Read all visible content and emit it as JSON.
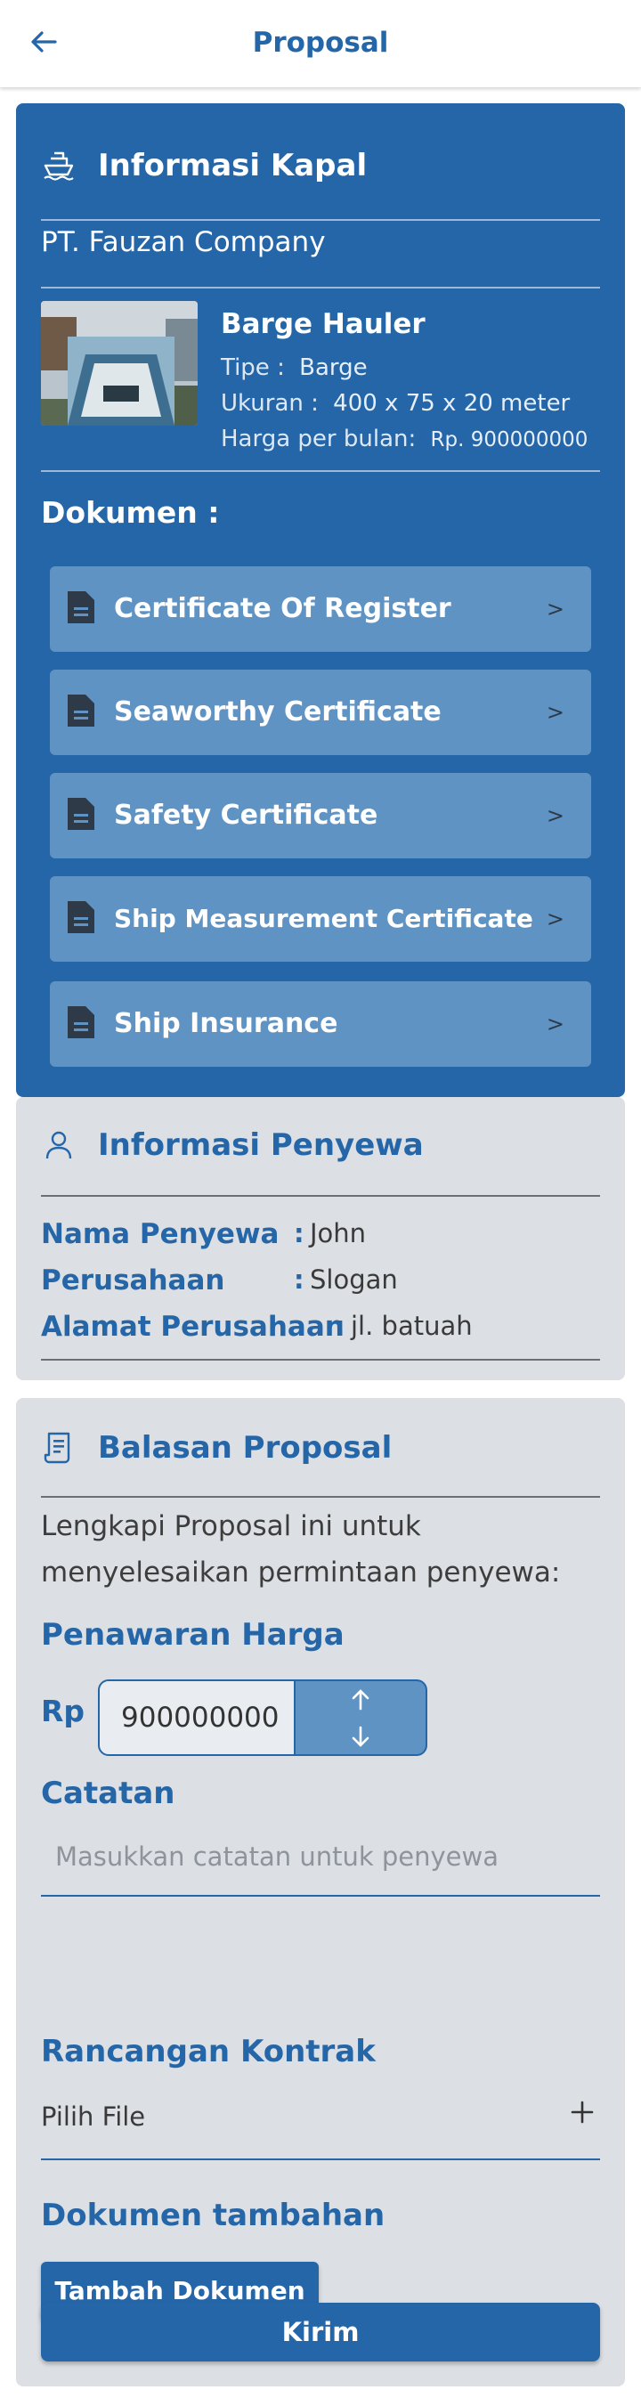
{
  "header": {
    "title": "Proposal",
    "back_icon": "arrow-left-icon"
  },
  "ship_info": {
    "title": "Informasi Kapal",
    "icon": "ship-icon",
    "company": "PT. Fauzan Company",
    "ship": {
      "name": "Barge Hauler",
      "type_label": "Tipe :",
      "type_value": "Barge",
      "size_label": "Ukuran :",
      "size_value": "400 x 75 x 20 meter",
      "price_label": "Harga per bulan:",
      "price_value": "Rp. 900000000"
    },
    "documents_title": "Dokumen :",
    "documents": [
      {
        "label": "Certificate Of Register",
        "chevron": ">"
      },
      {
        "label": "Seaworthy Certificate",
        "chevron": ">"
      },
      {
        "label": "Safety Certificate",
        "chevron": ">"
      },
      {
        "label": "Ship Measurement Certificate",
        "chevron": ">"
      },
      {
        "label": "Ship Insurance",
        "chevron": ">"
      }
    ]
  },
  "renter_info": {
    "title": "Informasi Penyewa",
    "icon": "user-icon",
    "rows": [
      {
        "key": "Nama Penyewa",
        "sep": ":",
        "value": "John"
      },
      {
        "key": "Perusahaan",
        "sep": ":",
        "value": "Slogan"
      },
      {
        "key": "Alamat Perusahaan",
        "sep": ":",
        "value": "jl. batuah"
      }
    ]
  },
  "proposal_reply": {
    "title": "Balasan Proposal",
    "icon": "receipt-icon",
    "intro": "Lengkapi Proposal ini untuk menyelesaikan permintaan penyewa:",
    "price_title": "Penawaran Harga",
    "currency": "Rp",
    "price_value": "900000000",
    "notes_title": "Catatan",
    "notes_placeholder": "Masukkan catatan untuk penyewa",
    "contract_title": "Rancangan Kontrak",
    "contract_file_label": "Pilih File",
    "extra_docs_title": "Dokumen tambahan",
    "add_doc_button": "Tambah Dokumen",
    "submit_button": "Kirim"
  },
  "colors": {
    "primary": "#2466a8",
    "doc_item": "#5f93c4",
    "card_grey": "#dcdfe3"
  }
}
